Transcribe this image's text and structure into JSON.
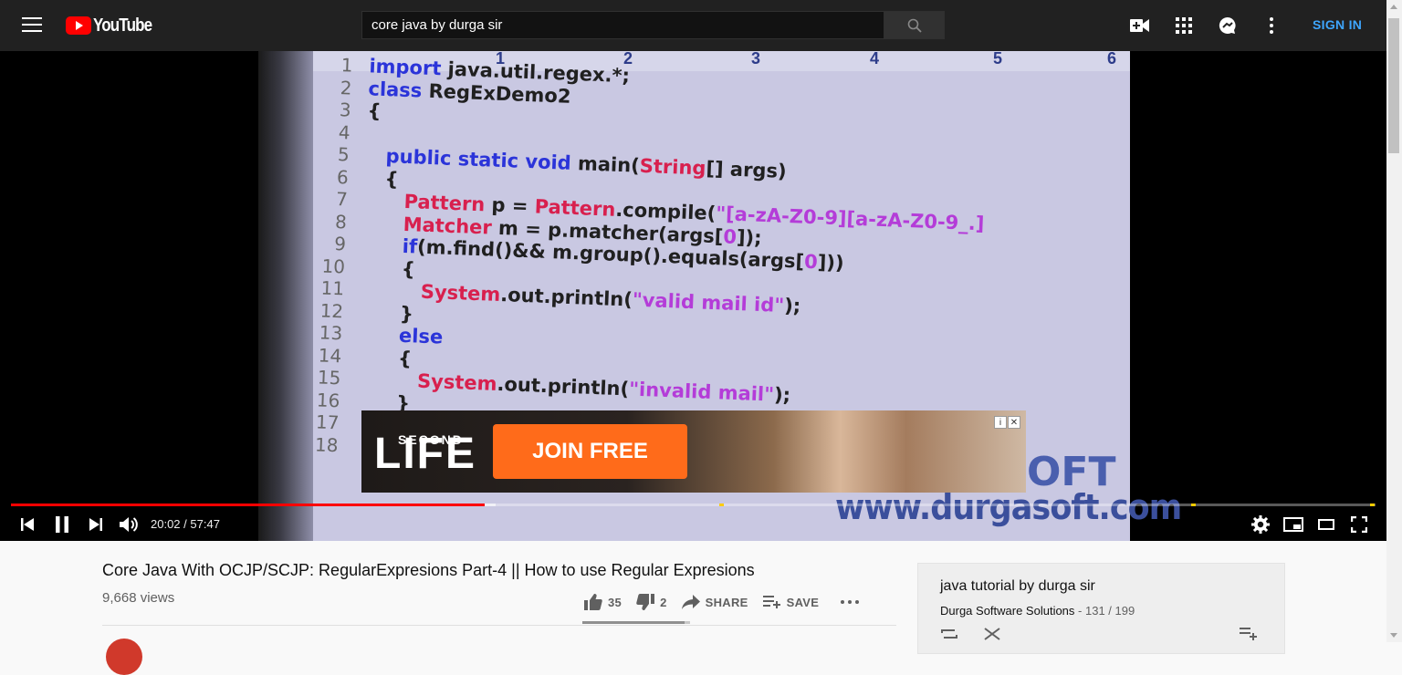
{
  "masthead": {
    "logo_text": "YouTube",
    "search_value": "core java by durga sir",
    "signin_label": "SIGN IN"
  },
  "player": {
    "time_current": "20:02",
    "time_separator": " / ",
    "time_total": "57:47",
    "progress_played_fraction": 0.347,
    "progress_buffered_fraction": 0.355,
    "ruler_numbers": [
      "1",
      "2",
      "3",
      "4",
      "5",
      "6"
    ],
    "code_lines": [
      {
        "n": "1",
        "html": "<span class='kw'>import</span> java.util.regex.*;"
      },
      {
        "n": "2",
        "html": "<span class='kw'>class</span> RegExDemo2"
      },
      {
        "n": "3",
        "html": "{"
      },
      {
        "n": "4",
        "html": ""
      },
      {
        "n": "5",
        "html": "&nbsp;&nbsp;&nbsp;<span class='kw'>public static void</span> main(<span class='ty'>String</span>[] args)"
      },
      {
        "n": "6",
        "html": "&nbsp;&nbsp;&nbsp;{"
      },
      {
        "n": "7",
        "html": "&nbsp;&nbsp;&nbsp;&nbsp;&nbsp;&nbsp;<span class='ty'>Pattern</span> p = <span class='ty'>Pattern</span>.compile(<span class='st'>\"[a-zA-Z0-9][a-zA-Z0-9_.]</span>"
      },
      {
        "n": "8",
        "html": "&nbsp;&nbsp;&nbsp;&nbsp;&nbsp;&nbsp;<span class='ty'>Matcher</span> m = p.matcher(args[<span class='st'>0</span>]);"
      },
      {
        "n": "9",
        "html": "&nbsp;&nbsp;&nbsp;&nbsp;&nbsp;&nbsp;<span class='kw'>if</span>(m.find()&amp;&amp; m.group().equals(args[<span class='st'>0</span>]))"
      },
      {
        "n": "10",
        "html": "&nbsp;&nbsp;&nbsp;&nbsp;&nbsp;&nbsp;{"
      },
      {
        "n": "11",
        "html": "&nbsp;&nbsp;&nbsp;&nbsp;&nbsp;&nbsp;&nbsp;&nbsp;&nbsp;<span class='ty'>System</span>.out.println(<span class='st'>\"valid mail id\"</span>);"
      },
      {
        "n": "12",
        "html": "&nbsp;&nbsp;&nbsp;&nbsp;&nbsp;&nbsp;}"
      },
      {
        "n": "13",
        "html": "&nbsp;&nbsp;&nbsp;&nbsp;&nbsp;&nbsp;<span class='kw'>else</span>"
      },
      {
        "n": "14",
        "html": "&nbsp;&nbsp;&nbsp;&nbsp;&nbsp;&nbsp;{"
      },
      {
        "n": "15",
        "html": "&nbsp;&nbsp;&nbsp;&nbsp;&nbsp;&nbsp;&nbsp;&nbsp;&nbsp;<span class='ty'>System</span>.out.println(<span class='st'>\"invalid mail\"</span>);"
      },
      {
        "n": "16",
        "html": "&nbsp;&nbsp;&nbsp;&nbsp;&nbsp;&nbsp;}"
      },
      {
        "n": "17",
        "html": "&nbsp;&nbsp;&nbsp;}"
      },
      {
        "n": "18",
        "html": ""
      }
    ],
    "watermark_brand": "OFT",
    "watermark_url": "www.durgasoft.com",
    "ad": {
      "brand_small": "SECOND",
      "brand_large": "LIFE",
      "button_label": "JOIN FREE",
      "info_glyph": "i",
      "close_glyph": "✕"
    }
  },
  "video": {
    "title": "Core Java With OCJP/SCJP: RegularExpresions Part-4 || How to use Regular Expresions",
    "views": "9,668 views",
    "likes": "35",
    "dislikes": "2",
    "share_label": "SHARE",
    "save_label": "SAVE",
    "like_ratio": 0.946
  },
  "playlist": {
    "title": "java tutorial by durga sir",
    "channel": "Durga Software Solutions",
    "position": "131 / 199",
    "position_separator": " - "
  },
  "colors": {
    "masthead_bg": "#212121",
    "accent_red": "#ff0000",
    "signin_blue": "#3ea6ff",
    "ad_button": "#ff6b1a"
  }
}
